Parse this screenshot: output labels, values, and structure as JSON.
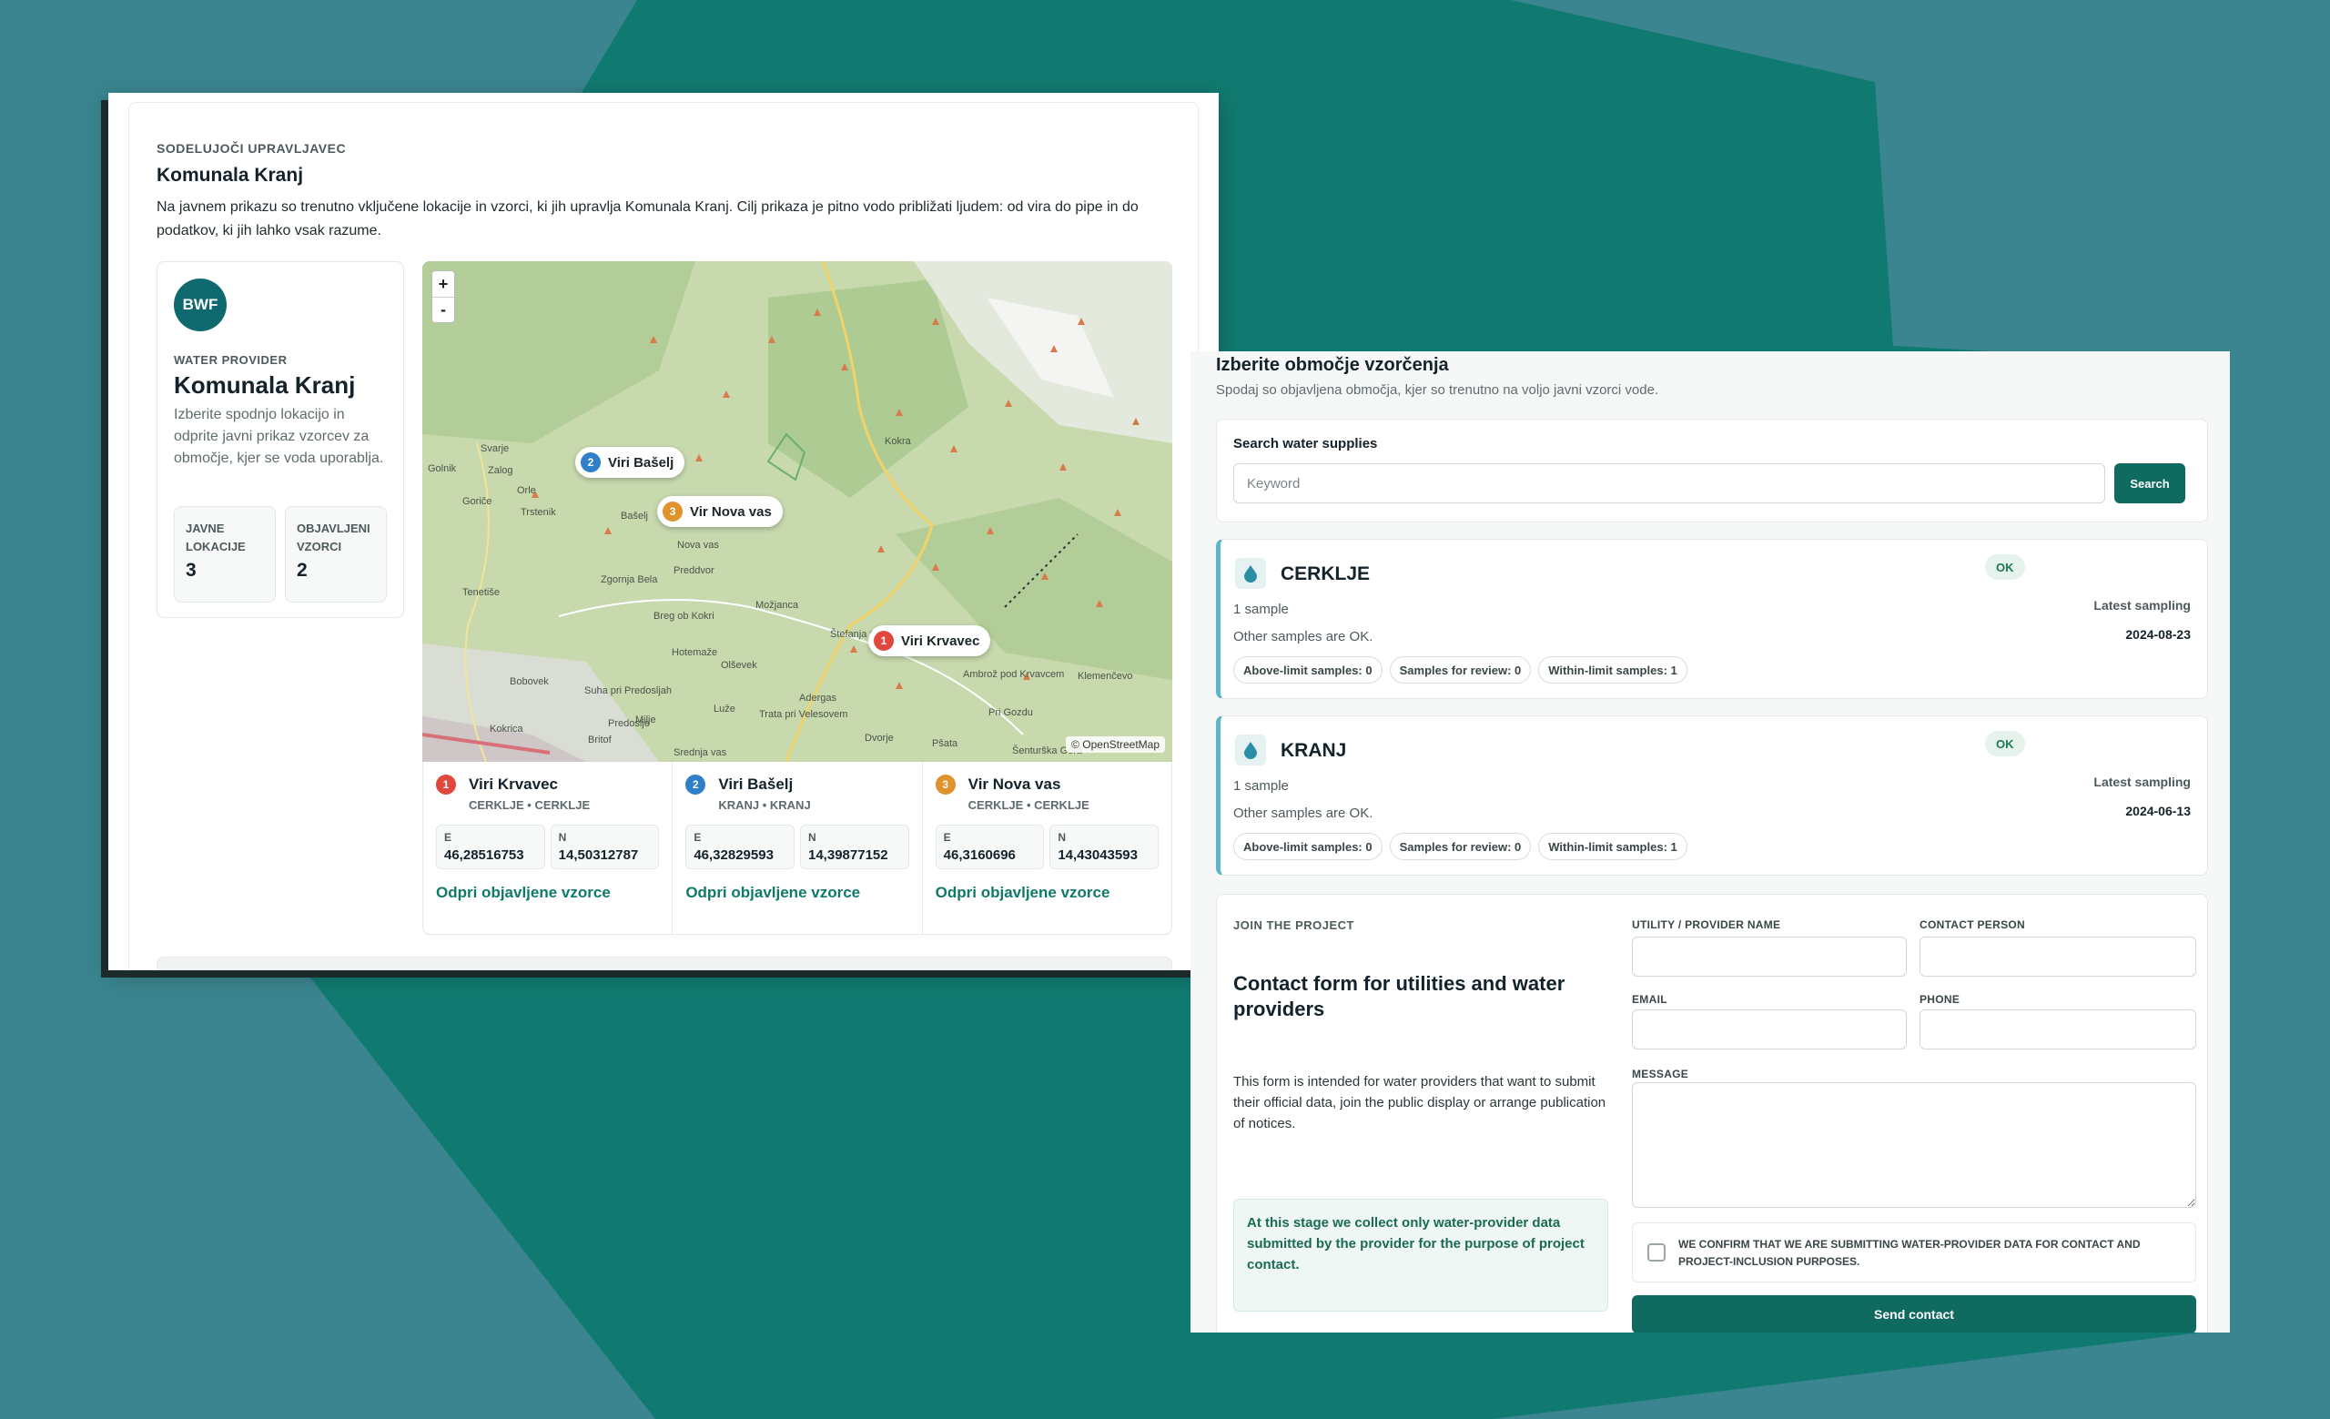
{
  "colors": {
    "accent": "#0f6a5f",
    "teal_bg": "#3a858f",
    "dark_teal": "#117a70",
    "ok": "#1c7a4e"
  },
  "left_panel": {
    "eyebrow": "SODELUJOČI UPRAVLJAVEC",
    "title": "Komunala Kranj",
    "description": "Na javnem prikazu so trenutno vključene lokacije in vzorci, ki jih upravlja Komunala Kranj. Cilj prikaza je pitno vodo približati ljudem: od vira do pipe in do podatkov, ki jih lahko vsak razume.",
    "provider": {
      "logo_text": "BWF",
      "eyebrow": "WATER PROVIDER",
      "name": "Komunala Kranj",
      "description": "Izberite spodnjo lokacijo in odprite javni prikaz vzorcev za območje, kjer se voda uporablja.",
      "stats": [
        {
          "label": "JAVNE LOKACIJE",
          "value": "3"
        },
        {
          "label": "OBJAVLJENI VZORCI",
          "value": "2"
        }
      ]
    },
    "map": {
      "zoom_in": "+",
      "zoom_out": "-",
      "attribution": "© OpenStreetMap",
      "pins": [
        {
          "num": "2",
          "label": "Viri Bašelj"
        },
        {
          "num": "3",
          "label": "Vir Nova vas"
        },
        {
          "num": "1",
          "label": "Viri Krvavec"
        }
      ],
      "places": [
        "Kokra",
        "Svarje",
        "Golnik",
        "Zalog",
        "Goriče",
        "Orle",
        "Trstenik",
        "Bašelj",
        "Nova vas",
        "Tenetiše",
        "Zgornja Bela",
        "Preddvor",
        "Možjanca",
        "Breg ob Kokri",
        "Hotemaže",
        "Olševek",
        "Bobovek",
        "Suha pri Predosljah",
        "Lužе",
        "Adergas",
        "Ambrož pod Krvavcem",
        "Štefanja Gora",
        "Klemenčevo",
        "Pri Gozdu",
        "Milje",
        "Predoslje",
        "Kokrica",
        "Britof",
        "Trata pri Velesovem",
        "Dvorje",
        "Pšata",
        "Šenturška Gora",
        "Srednja vas"
      ]
    },
    "locations": [
      {
        "num": "1",
        "name": "Viri Krvavec",
        "sub": "CERKLJE • CERKLJE",
        "e_label": "E",
        "e": "46,28516753",
        "n_label": "N",
        "n": "14,50312787",
        "link": "Odpri objavljene vzorce"
      },
      {
        "num": "2",
        "name": "Viri Bašelj",
        "sub": "KRANJ • KRANJ",
        "e_label": "E",
        "e": "46,32829593",
        "n_label": "N",
        "n": "14,39877152",
        "link": "Odpri objavljene vzorce"
      },
      {
        "num": "3",
        "name": "Vir Nova vas",
        "sub": "CERKLJE • CERKLJE",
        "e_label": "E",
        "e": "46,3160696",
        "n_label": "N",
        "n": "14,43043593",
        "link": "Odpri objavljene vzorce"
      }
    ]
  },
  "right_panel": {
    "title": "Izberite območje vzorčenja",
    "subtitle": "Spodaj so objavljena območja, kjer so trenutno na voljo javni vzorci vode.",
    "search": {
      "label": "Search water supplies",
      "placeholder": "Keyword",
      "button": "Search"
    },
    "areas": [
      {
        "name": "CERKLJE",
        "status": "OK",
        "count": "1 sample",
        "note": "Other samples are OK.",
        "latest_label": "Latest sampling",
        "latest_date": "2024-08-23",
        "chips": [
          "Above-limit samples: 0",
          "Samples for review: 0",
          "Within-limit samples: 1"
        ]
      },
      {
        "name": "KRANJ",
        "status": "OK",
        "count": "1 sample",
        "note": "Other samples are OK.",
        "latest_label": "Latest sampling",
        "latest_date": "2024-06-13",
        "chips": [
          "Above-limit samples: 0",
          "Samples for review: 0",
          "Within-limit samples: 1"
        ]
      }
    ],
    "contact": {
      "eyebrow": "JOIN THE PROJECT",
      "title": "Contact form for utilities and water providers",
      "description": "This form is intended for water providers that want to submit their official data, join the public display or arrange publication of notices.",
      "note": "At this stage we collect only water-provider data submitted by the provider for the purpose of project contact.",
      "fields": {
        "provider_name": "UTILITY / PROVIDER NAME",
        "contact_person": "CONTACT PERSON",
        "email": "EMAIL",
        "phone": "PHONE",
        "message": "MESSAGE"
      },
      "confirm": "WE CONFIRM THAT WE ARE SUBMITTING WATER-PROVIDER DATA FOR CONTACT AND PROJECT-INCLUSION PURPOSES.",
      "submit": "Send contact"
    }
  }
}
